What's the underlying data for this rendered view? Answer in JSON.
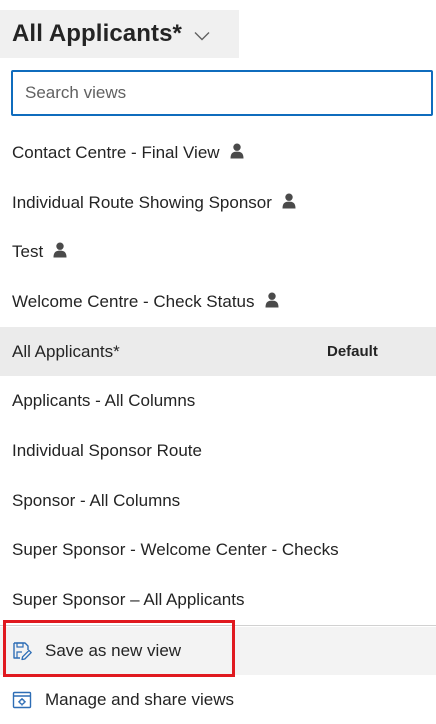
{
  "header": {
    "title": "All Applicants*"
  },
  "search": {
    "placeholder": "Search views"
  },
  "personal_views": [
    {
      "label": "Contact Centre - Final View"
    },
    {
      "label": "Individual Route Showing Sponsor"
    },
    {
      "label": "Test"
    },
    {
      "label": "Welcome Centre - Check Status"
    }
  ],
  "system_views": [
    {
      "label": "All Applicants*",
      "badge": "Default"
    },
    {
      "label": "Applicants - All Columns"
    },
    {
      "label": "Individual Sponsor Route"
    },
    {
      "label": "Sponsor - All Columns"
    },
    {
      "label": "Super Sponsor - Welcome Center - Checks"
    },
    {
      "label": "Super Sponsor – All Applicants"
    }
  ],
  "actions": {
    "save_as_new": "Save as new view",
    "manage": "Manage and share views"
  },
  "colors": {
    "accent": "#0f6cbd",
    "highlight_border": "#e0191f",
    "selected_bg": "#ebebeb"
  },
  "icons": {
    "chevron": "chevron-down-icon",
    "personal": "person-icon",
    "save": "save-edit-icon",
    "manage": "settings-window-icon"
  }
}
